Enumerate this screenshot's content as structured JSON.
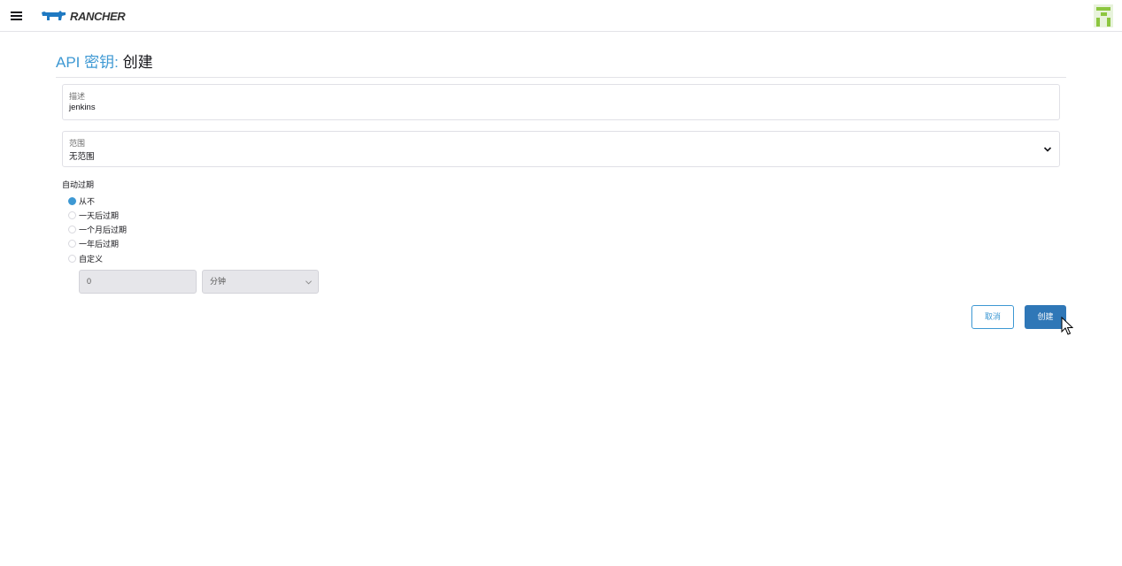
{
  "header": {
    "logo_text": "RANCHER",
    "logo_color": "#1f79c2"
  },
  "page": {
    "title_prefix": "API 密钥:",
    "title_main": "创建"
  },
  "form": {
    "description": {
      "label": "描述",
      "value": "jenkins"
    },
    "scope": {
      "label": "范围",
      "value": "无范围"
    },
    "expiry": {
      "label": "自动过期",
      "options": [
        {
          "label": "从不",
          "checked": true
        },
        {
          "label": "一天后过期",
          "checked": false
        },
        {
          "label": "一个月后过期",
          "checked": false
        },
        {
          "label": "一年后过期",
          "checked": false
        },
        {
          "label": "自定义",
          "checked": false
        }
      ],
      "custom_value": "0",
      "custom_unit": "分钟"
    }
  },
  "actions": {
    "cancel_label": "取消",
    "create_label": "创建"
  },
  "colors": {
    "accent": "#3d98d3",
    "primary_button": "#2f77b7"
  }
}
